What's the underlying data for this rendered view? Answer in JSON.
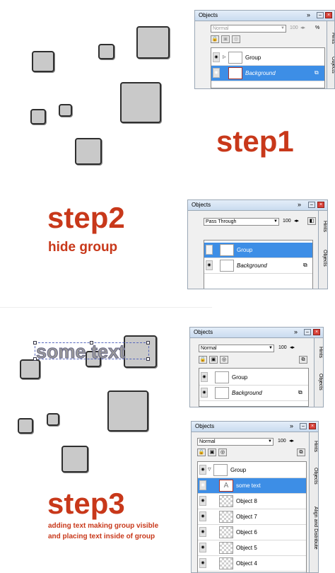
{
  "steps": {
    "step1": "step1",
    "step2": "step2",
    "step2_sub": "hide group",
    "step3": "step3",
    "step3_sub1": "adding text making group visible",
    "step3_sub2": "and placing text inside of group"
  },
  "canvas_text": "some text",
  "panel1": {
    "title": "Objects",
    "blend": "Normal",
    "opacity": "100",
    "percent": "%",
    "rows": [
      "Group",
      "Background"
    ],
    "tabs": [
      "Hints",
      "Objects"
    ]
  },
  "panel2": {
    "title": "Objects",
    "blend": "Pass Through",
    "opacity": "100",
    "rows": [
      "Group",
      "Background"
    ],
    "tabs": [
      "Hints",
      "Objects"
    ]
  },
  "panel3": {
    "title": "Objects",
    "blend": "Normal",
    "opacity": "100",
    "rows": [
      "Group",
      "Background"
    ],
    "tabs": [
      "Hints",
      "Objects"
    ]
  },
  "panel4": {
    "title": "Objects",
    "blend": "Normal",
    "opacity": "100",
    "rows": [
      "Group",
      "some text",
      "Object 8",
      "Object 7",
      "Object 6",
      "Object 5",
      "Object 4"
    ],
    "tabs": [
      "Hints",
      "Objects",
      "Align and Distribute"
    ]
  },
  "icons": {
    "expand": "double-chevron-icon",
    "minimize": "minimize-icon",
    "close": "close-icon",
    "eye": "eye-icon",
    "lock": "lock-icon",
    "text_layer": "text-A-icon"
  },
  "colors": {
    "step_red": "#c8381a",
    "selected_row": "#3d8ee6",
    "square_fill": "#c9c9c9"
  }
}
